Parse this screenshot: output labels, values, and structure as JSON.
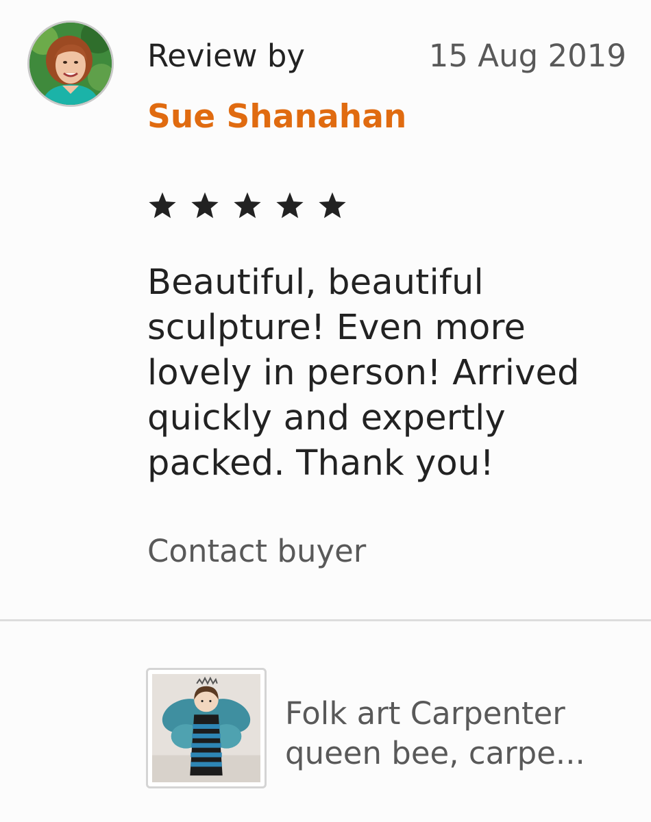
{
  "review": {
    "label": "Review by",
    "date": "15 Aug 2019",
    "reviewer_name": "Sue Shanahan",
    "rating": 5,
    "rating_max": 5,
    "text": "Beautiful, beautiful sculpture! Even more lovely in person! Arrived quickly and expertly packed. Thank you!",
    "contact_label": "Contact buyer"
  },
  "listing": {
    "title_line1": "Folk art Carpenter",
    "title_line2": "queen bee, carpe..."
  },
  "colors": {
    "accent": "#e06b10",
    "text": "#222222",
    "muted": "#595959",
    "divider": "#dcdcdc"
  },
  "icons": {
    "avatar": "reviewer-avatar-photo",
    "star": "star-icon",
    "thumbnail": "queen-bee-sculpture-photo"
  }
}
